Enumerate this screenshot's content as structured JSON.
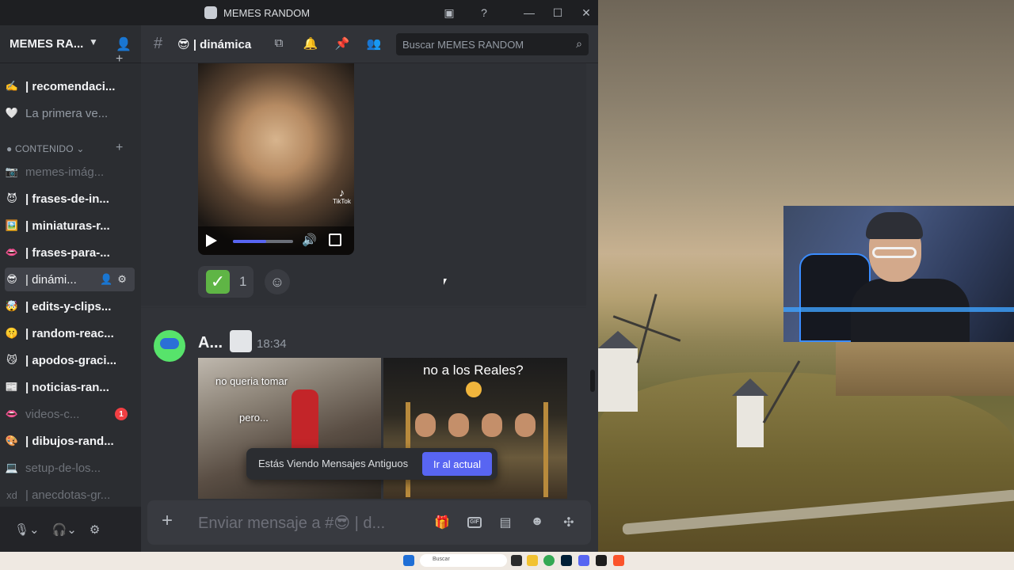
{
  "window": {
    "title": "MEMES RANDOM"
  },
  "server": {
    "name": "MEMES RA..."
  },
  "channels": [
    {
      "emoji": "✍️",
      "name": "| recomendaci...",
      "state": "bright"
    },
    {
      "emoji": "🤍",
      "name": "La primera ve...",
      "state": "normal"
    }
  ],
  "category": {
    "name": "CONTENIDO"
  },
  "content_channels": [
    {
      "emoji": "📷",
      "name": "memes-imág...",
      "state": "dim"
    },
    {
      "emoji": "😈",
      "name": "| frases-de-in...",
      "state": "bright"
    },
    {
      "emoji": "🖼️",
      "name": "| miniaturas-r...",
      "state": "bright"
    },
    {
      "emoji": "👄",
      "name": "| frases-para-...",
      "state": "bright"
    },
    {
      "emoji": "😎",
      "name": "| dinámi...",
      "state": "active"
    },
    {
      "emoji": "🤯",
      "name": "| edits-y-clips...",
      "state": "bright"
    },
    {
      "emoji": "🤫",
      "name": "| random-reac...",
      "state": "bright"
    },
    {
      "emoji": "😼",
      "name": "| apodos-graci...",
      "state": "bright"
    },
    {
      "emoji": "📰",
      "name": "| noticias-ran...",
      "state": "bright"
    },
    {
      "emoji": "👄",
      "name": "videos-c...",
      "state": "dim",
      "badge": "1"
    },
    {
      "emoji": "🎨",
      "name": "| dibujos-rand...",
      "state": "bright"
    },
    {
      "emoji": "💻",
      "name": "setup-de-los...",
      "state": "dim"
    },
    {
      "emoji": "xd",
      "name": "| anecdotas-gr...",
      "state": "dim"
    }
  ],
  "header": {
    "channel_emoji": "😎",
    "channel_name": "| dinámica",
    "search_placeholder": "Buscar MEMES RANDOM"
  },
  "messages": {
    "video": {
      "watermark": "TikTok",
      "progress": 0.55
    },
    "reaction": {
      "count": "1"
    },
    "author": "A...",
    "timestamp": "18:34",
    "image1": {
      "caption_top": "no queria tomar",
      "caption_bottom": "pero..."
    },
    "image2": {
      "caption_top": "no a los Reales?"
    }
  },
  "toast": {
    "text": "Estás Viendo Mensajes Antiguos",
    "button": "Ir al actual"
  },
  "composer": {
    "placeholder": "Enviar mensaje a #😎 | d..."
  },
  "taskbar": {
    "search_label": "Buscar"
  }
}
